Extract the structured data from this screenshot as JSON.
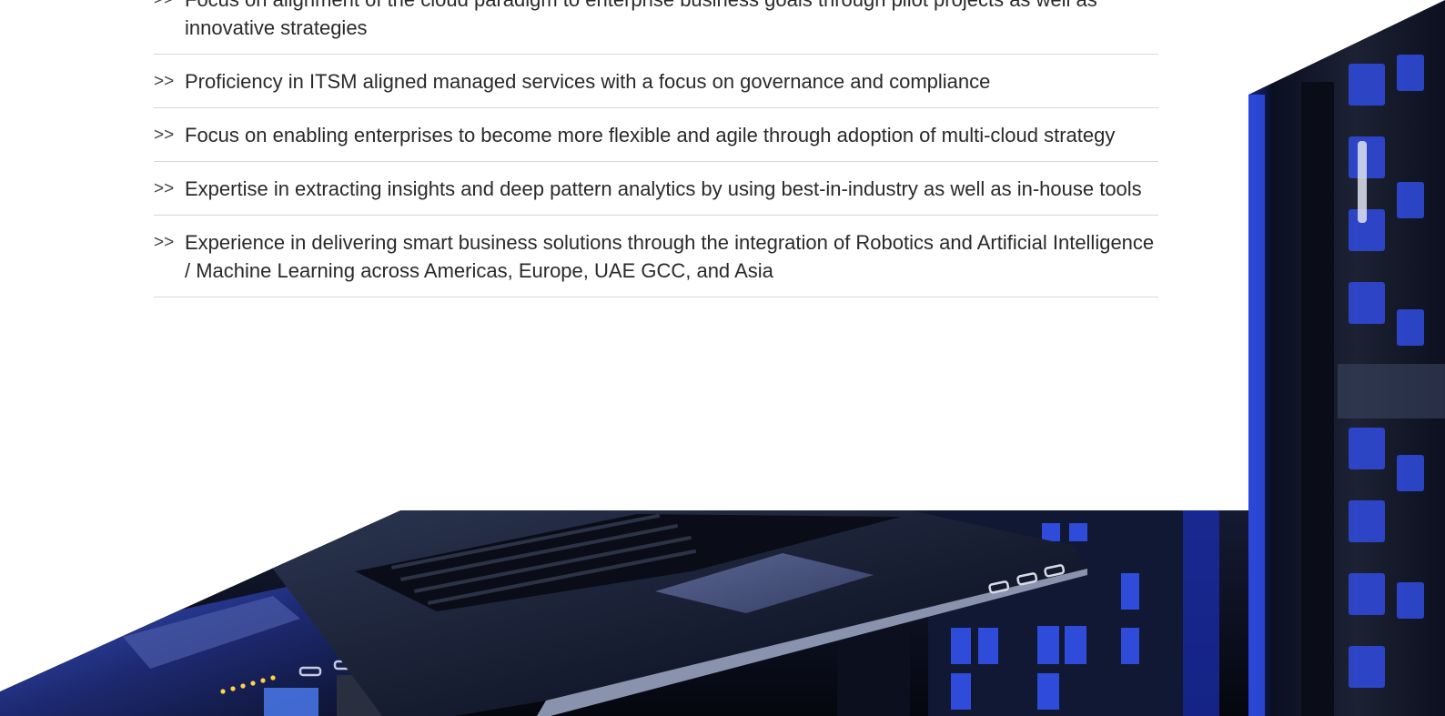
{
  "features": {
    "arrow": ">>",
    "items": [
      {
        "text": "Focus on alignment of the cloud paradigm to enterprise business goals through pilot projects as well as innovative strategies"
      },
      {
        "text": "Proficiency in ITSM aligned managed services with a focus on governance and compliance"
      },
      {
        "text": "Focus on enabling enterprises to become more flexible and agile through adoption of multi-cloud strategy"
      },
      {
        "text": "Expertise in extracting insights and deep pattern analytics by using best-in-industry as well as in-house tools"
      },
      {
        "text": "Experience in delivering smart business solutions through the integration of Robotics and Artificial Intelligence / Machine Learning across Americas, Europe, UAE GCC, and Asia"
      }
    ]
  },
  "colors": {
    "text": "#2a2a2a",
    "divider": "#d8d8d8",
    "rack_dark": "#0d1224",
    "rack_blue": "#2f49d6",
    "glow_blue": "#3b5bff"
  }
}
